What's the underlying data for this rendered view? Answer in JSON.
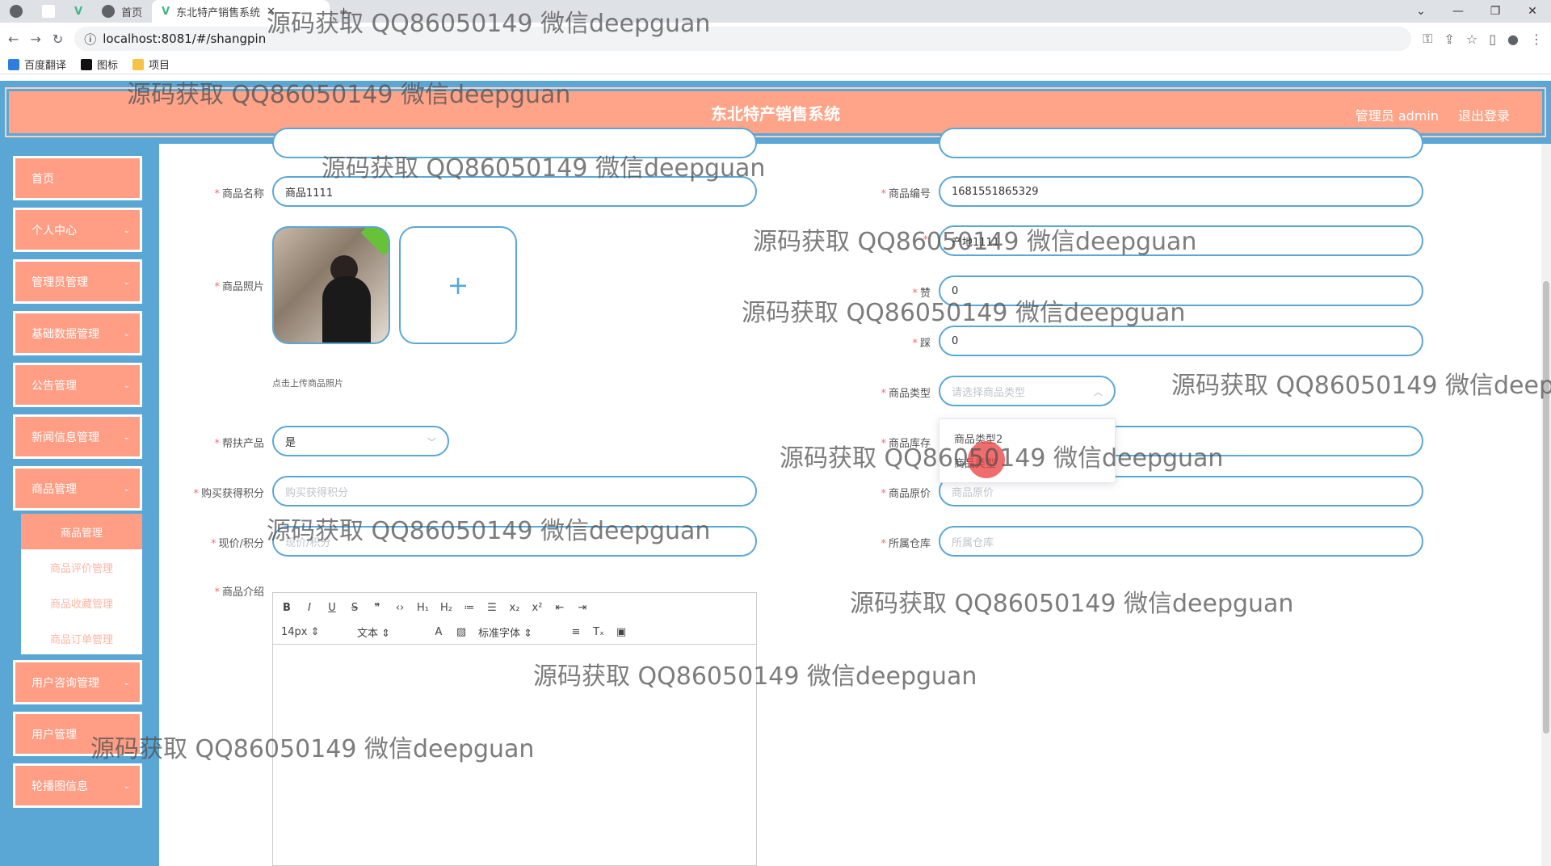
{
  "browser": {
    "tabs": [
      {
        "label": ""
      },
      {
        "label": ""
      },
      {
        "label": ""
      },
      {
        "label": "首页"
      },
      {
        "label": "东北特产销售系统"
      }
    ],
    "url": "localhost:8081/#/shangpin",
    "bookmarks": [
      {
        "label": "百度翻译",
        "color": "#2f7de1"
      },
      {
        "label": "图标",
        "color": "#111111"
      },
      {
        "label": "项目",
        "color": "#f6c344"
      }
    ],
    "window_controls": [
      "⌄",
      "—",
      "❐",
      "✕"
    ]
  },
  "header": {
    "title": "东北特产销售系统",
    "user": "管理员 admin",
    "logout": "退出登录"
  },
  "sidebar": {
    "items": [
      {
        "label": "首页",
        "has_arrow": false
      },
      {
        "label": "个人中心",
        "has_arrow": true
      },
      {
        "label": "管理员管理",
        "has_arrow": true
      },
      {
        "label": "基础数据管理",
        "has_arrow": true
      },
      {
        "label": "公告管理",
        "has_arrow": true
      },
      {
        "label": "新闻信息管理",
        "has_arrow": true
      },
      {
        "label": "商品管理",
        "has_arrow": true
      },
      {
        "label": "用户咨询管理",
        "has_arrow": true
      },
      {
        "label": "用户管理",
        "has_arrow": false
      },
      {
        "label": "轮播图信息",
        "has_arrow": true
      }
    ],
    "submenu": [
      {
        "label": "商品管理",
        "active": true
      },
      {
        "label": "商品评价管理",
        "active": false
      },
      {
        "label": "商品收藏管理",
        "active": false
      },
      {
        "label": "商品订单管理",
        "active": false
      }
    ]
  },
  "form": {
    "name_label": "商品名称",
    "name_value": "商品1111",
    "code_label": "商品编号",
    "code_value": "1681551865329",
    "origin_value": "产地1111",
    "photo_label": "商品照片",
    "photo_hint": "点击上传商品照片",
    "like_label": "赞",
    "like_value": "0",
    "dislike_label": "踩",
    "dislike_value": "0",
    "type_label": "商品类型",
    "type_placeholder": "请选择商品类型",
    "type_options": [
      "商品类型2",
      "商品类型"
    ],
    "help_label": "帮扶产品",
    "help_value": "是",
    "stock_label": "商品库存",
    "points_label": "购买获得积分",
    "points_placeholder": "购买获得积分",
    "price_label": "商品原价",
    "price_placeholder": "商品原价",
    "now_label": "现价/积分",
    "now_placeholder": "现价/积分",
    "warehouse_label": "所属仓库",
    "warehouse_placeholder": "所属仓库",
    "intro_label": "商品介绍",
    "editor": {
      "font_size": "14px",
      "text_type": "文本",
      "font_family": "标准字体"
    }
  },
  "watermark": "源码获取 QQ86050149 微信deepguan",
  "colors": {
    "accent": "#5aa7d6",
    "header": "#ffa488",
    "menu": "#ff9e85",
    "required": "#f56c6c"
  }
}
